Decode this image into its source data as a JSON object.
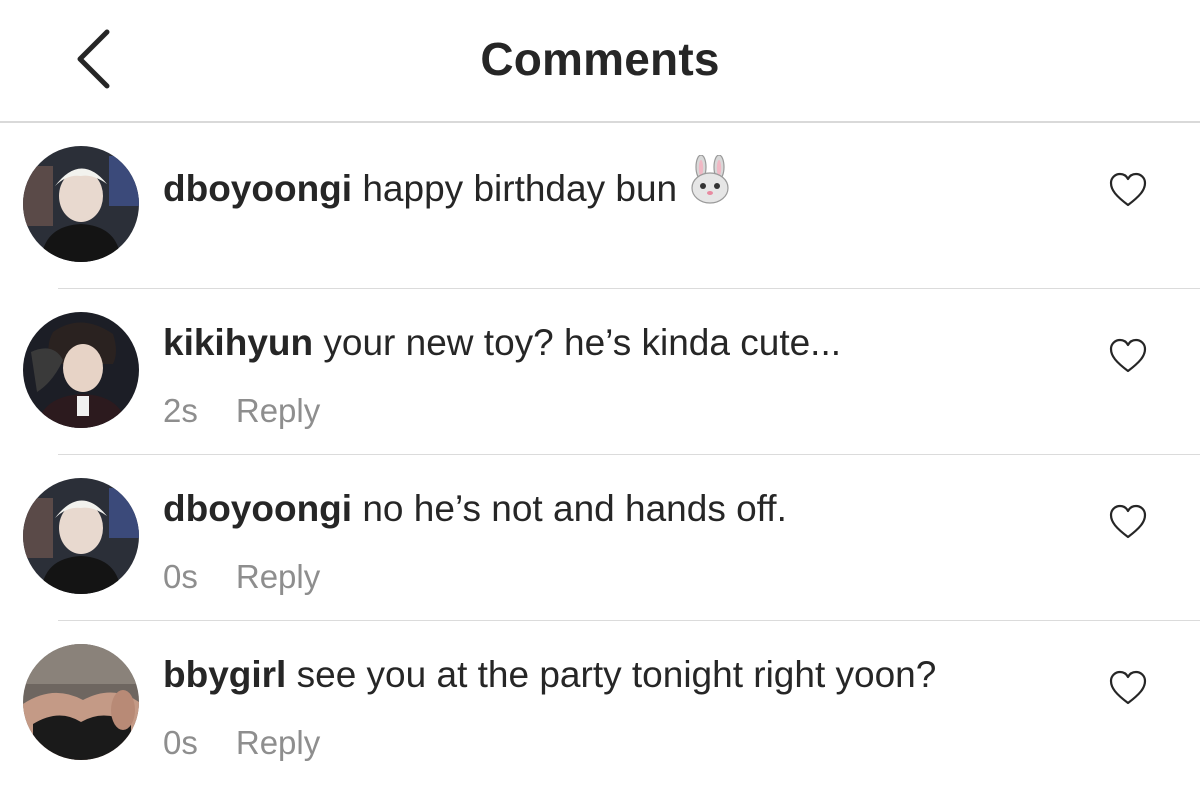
{
  "header": {
    "title": "Comments",
    "back_icon": "chevron-left-icon"
  },
  "comments": [
    {
      "username": "dboyoongi",
      "text": "happy birthday bun",
      "emoji": "rabbit-face-icon",
      "time": "",
      "reply_label": ""
    },
    {
      "username": "kikihyun",
      "text": "your new toy? he’s kinda cute...",
      "time": "2s",
      "reply_label": "Reply"
    },
    {
      "username": "dboyoongi",
      "text": "no he’s not and hands off.",
      "time": "0s",
      "reply_label": "Reply"
    },
    {
      "username": "bbygirl",
      "text": "see you at the party tonight right yoon?",
      "time": "0s",
      "reply_label": "Reply"
    }
  ],
  "colors": {
    "text": "#262626",
    "secondary": "#8e8e8e",
    "divider": "#dbdbdb"
  }
}
